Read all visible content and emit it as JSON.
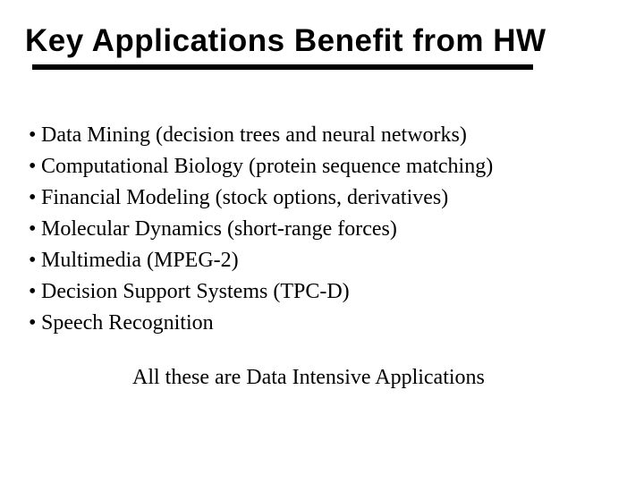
{
  "title": "Key Applications Benefit from HW",
  "bullets": [
    "Data Mining (decision trees and neural networks)",
    "Computational Biology (protein sequence matching)",
    "Financial Modeling (stock options, derivatives)",
    "Molecular Dynamics (short-range forces)",
    "Multimedia (MPEG-2)",
    "Decision Support Systems (TPC-D)",
    "Speech Recognition"
  ],
  "footer": "All these are Data Intensive Applications"
}
